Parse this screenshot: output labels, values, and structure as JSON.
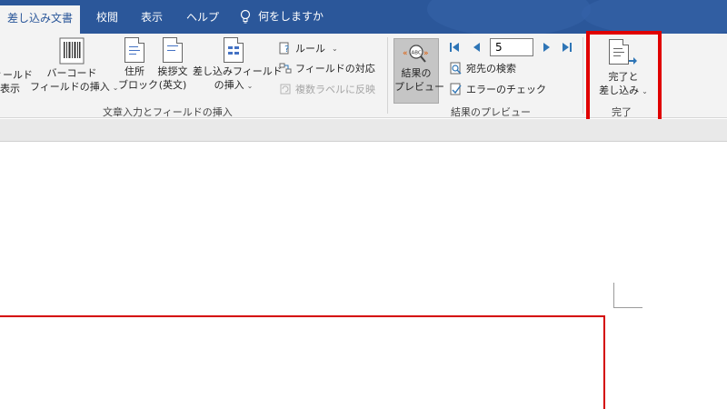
{
  "tabs": {
    "active": "差し込み文書",
    "review": "校閲",
    "view": "表示",
    "help": "ヘルプ",
    "tell_me": "何をしますか"
  },
  "ribbon": {
    "write_insert": {
      "partial_button": {
        "line1": "ィールド",
        "line2": "表示"
      },
      "barcode": {
        "line1": "バーコード",
        "line2": "フィールドの挿入"
      },
      "address_block": {
        "line1": "住所",
        "line2": "ブロック"
      },
      "greeting": {
        "line1": "挨拶文",
        "line2": "(英文)"
      },
      "insert_merge_field": {
        "line1": "差し込みフィールド",
        "line2": "の挿入"
      },
      "rules": "ルール",
      "match_fields": "フィールドの対応",
      "update_labels": "複数ラベルに反映",
      "group_label": "文章入力とフィールドの挿入"
    },
    "preview": {
      "preview_results": {
        "line1": "結果の",
        "line2": "プレビュー"
      },
      "record_number": "5",
      "find_recipient": "宛先の検索",
      "check_errors": "エラーのチェック",
      "group_label": "結果のプレビュー"
    },
    "finish": {
      "finish_merge": {
        "line1": "完了と",
        "line2": "差し込み"
      },
      "group_label": "完了"
    }
  },
  "colors": {
    "tab_bar": "#2b579a",
    "highlight": "#e00000",
    "nav_arrow": "#2e75b6"
  }
}
